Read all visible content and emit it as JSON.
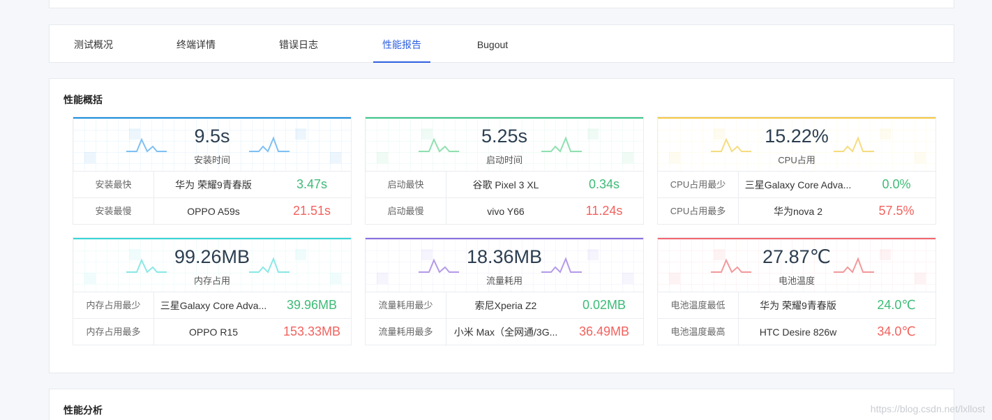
{
  "tabs": [
    {
      "label": "测试概况",
      "active": false
    },
    {
      "label": "终端详情",
      "active": false
    },
    {
      "label": "错误日志",
      "active": false
    },
    {
      "label": "性能报告",
      "active": true
    },
    {
      "label": "Bugout",
      "active": false
    }
  ],
  "overview": {
    "title": "性能概括",
    "cards": [
      {
        "value": "9.5s",
        "label": "安装时间",
        "color": "#1e90e0",
        "spark_color": "#7fc0f2",
        "rows": [
          {
            "label": "安装最快",
            "device": "华为 荣耀9青春版",
            "value": "3.47s",
            "status": "good"
          },
          {
            "label": "安装最慢",
            "device": "OPPO A59s",
            "value": "21.51s",
            "status": "bad"
          }
        ]
      },
      {
        "value": "5.25s",
        "label": "启动时间",
        "color": "#3dc88a",
        "spark_color": "#8fe0b0",
        "rows": [
          {
            "label": "启动最快",
            "device": "谷歌 Pixel 3 XL",
            "value": "0.34s",
            "status": "good"
          },
          {
            "label": "启动最慢",
            "device": "vivo Y66",
            "value": "11.24s",
            "status": "bad"
          }
        ]
      },
      {
        "value": "15.22%",
        "label": "CPU占用",
        "color": "#f5c842",
        "spark_color": "#f5dc7f",
        "rows": [
          {
            "label": "CPU占用最少",
            "device": "三星Galaxy Core Adva...",
            "value": "0.0%",
            "status": "good"
          },
          {
            "label": "CPU占用最多",
            "device": "华为nova 2",
            "value": "57.5%",
            "status": "bad"
          }
        ]
      },
      {
        "value": "99.26MB",
        "label": "内存占用",
        "color": "#3ad6d6",
        "spark_color": "#8ae8e6",
        "rows": [
          {
            "label": "内存占用最少",
            "device": "三星Galaxy Core Adva...",
            "value": "39.96MB",
            "status": "good"
          },
          {
            "label": "内存占用最多",
            "device": "OPPO R15",
            "value": "153.33MB",
            "status": "bad"
          }
        ]
      },
      {
        "value": "18.36MB",
        "label": "流量耗用",
        "color": "#8b6ee0",
        "spark_color": "#b49ae8",
        "rows": [
          {
            "label": "流量耗用最少",
            "device": "索尼Xperia Z2",
            "value": "0.02MB",
            "status": "good"
          },
          {
            "label": "流量耗用最多",
            "device": "小米 Max（全网通/3G...",
            "value": "36.49MB",
            "status": "bad"
          }
        ]
      },
      {
        "value": "27.87℃",
        "label": "电池温度",
        "color": "#f06870",
        "spark_color": "#f2999b",
        "rows": [
          {
            "label": "电池温度最低",
            "device": "华为 荣耀9青春版",
            "value": "24.0℃",
            "status": "good"
          },
          {
            "label": "电池温度最高",
            "device": "HTC Desire 826w",
            "value": "34.0℃",
            "status": "bad"
          }
        ]
      }
    ]
  },
  "analysis": {
    "title": "性能分析"
  },
  "watermark": "https://blog.csdn.net/lxllost"
}
